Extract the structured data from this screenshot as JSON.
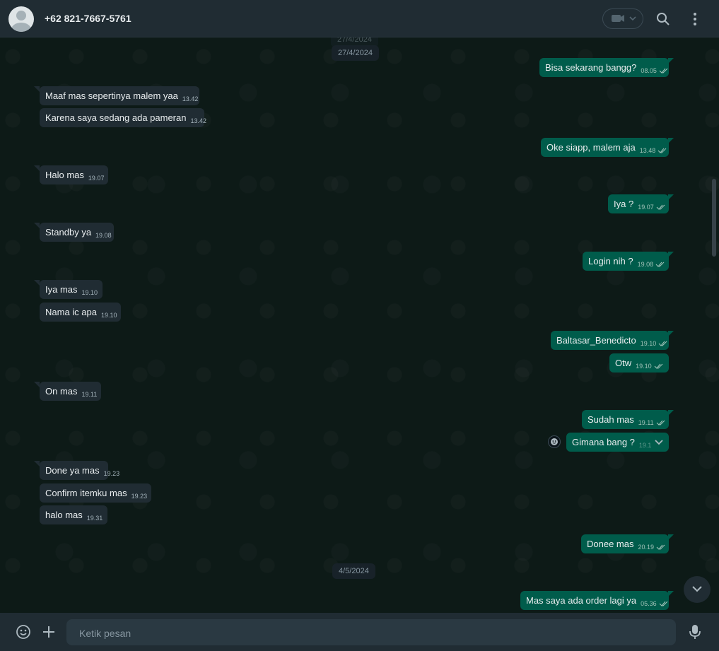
{
  "header": {
    "contact_name": "+62 821-7667-5761",
    "icons": {
      "avatar": "default-avatar-icon",
      "video": "video-call-icon",
      "search": "search-icon",
      "menu": "more-options-icon"
    }
  },
  "chat": {
    "date_chips": [
      "27/4/2024",
      "27/4/2024",
      "4/5/2024"
    ],
    "messages": [
      {
        "dir": "out",
        "text": "Bisa sekarang bangg?",
        "time": "08.05",
        "ticks": true
      },
      {
        "dir": "in",
        "text": "Maaf mas sepertinya malem yaa",
        "time": "13.42"
      },
      {
        "dir": "in",
        "text": "Karena saya sedang ada pameran",
        "time": "13.42"
      },
      {
        "dir": "out",
        "text": "Oke siapp, malem aja",
        "time": "13.48",
        "ticks": true
      },
      {
        "dir": "in",
        "text": "Halo mas",
        "time": "19.07"
      },
      {
        "dir": "out",
        "text": "Iya ?",
        "time": "19.07",
        "ticks": true
      },
      {
        "dir": "in",
        "text": "Standby ya",
        "time": "19.08"
      },
      {
        "dir": "out",
        "text": "Login nih ?",
        "time": "19.08",
        "ticks": true
      },
      {
        "dir": "in",
        "text": "Iya mas",
        "time": "19.10"
      },
      {
        "dir": "in",
        "text": "Nama ic apa",
        "time": "19.10"
      },
      {
        "dir": "out",
        "text": "Baltasar_Benedicto",
        "time": "19.10",
        "ticks": true
      },
      {
        "dir": "out",
        "text": "Otw",
        "time": "19.10",
        "ticks": true
      },
      {
        "dir": "in",
        "text": "On mas",
        "time": "19.11"
      },
      {
        "dir": "out",
        "text": "Sudah mas",
        "time": "19.11",
        "ticks": true
      },
      {
        "dir": "out",
        "text": "Gimana bang ?",
        "time": "19.1",
        "ticks": false
      },
      {
        "dir": "in",
        "text": "Done ya mas",
        "time": "19.23"
      },
      {
        "dir": "in",
        "text": "Confirm itemku mas",
        "time": "19.23"
      },
      {
        "dir": "in",
        "text": "halo mas",
        "time": "19.31"
      },
      {
        "dir": "out",
        "text": "Donee mas",
        "time": "20.19",
        "ticks": true
      },
      {
        "dir": "out",
        "text": "Mas saya ada order lagi ya",
        "time": "05.36",
        "ticks": true
      }
    ]
  },
  "composer": {
    "placeholder": "Ketik pesan",
    "icons": {
      "emoji": "emoji-icon",
      "attach": "plus-icon",
      "mic": "microphone-icon"
    }
  },
  "colors": {
    "header_bg": "#202c33",
    "chat_bg": "#0d1a17",
    "out_bubble": "#005c4b",
    "in_bubble": "#202c33",
    "tick": "#9fc2b8"
  }
}
